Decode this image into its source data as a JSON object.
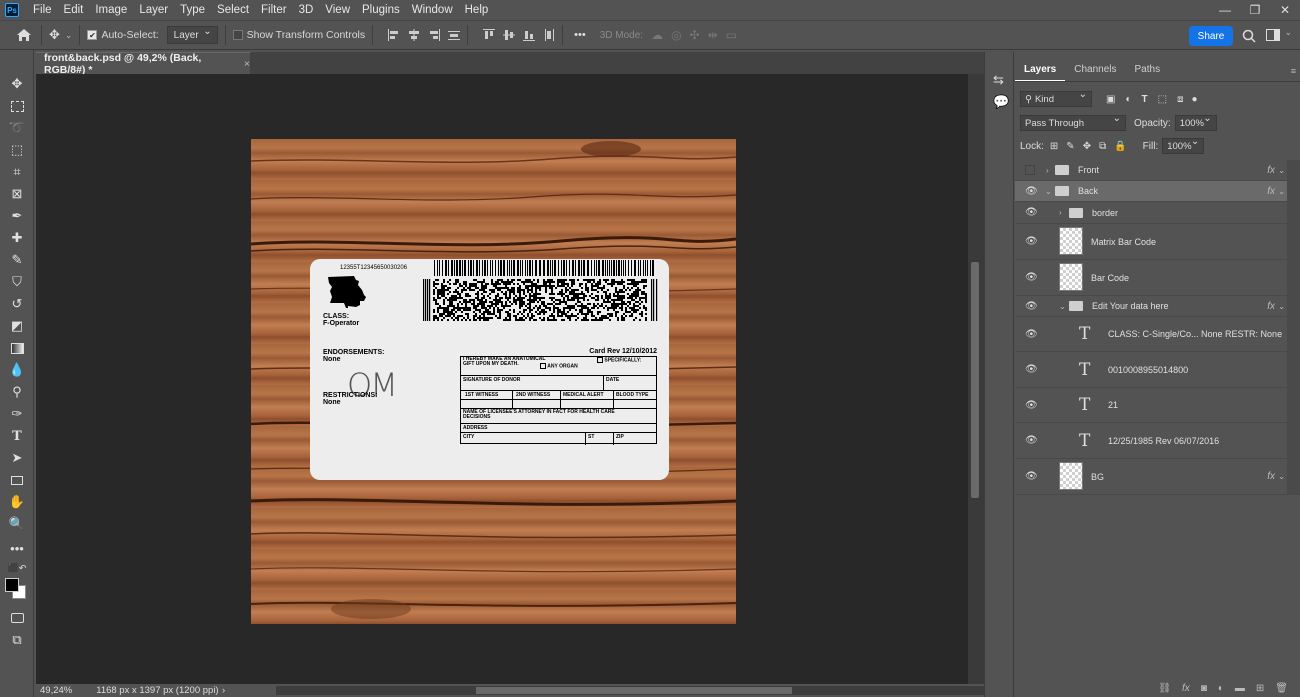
{
  "app": {
    "logo": "Ps"
  },
  "menu": [
    "File",
    "Edit",
    "Image",
    "Layer",
    "Type",
    "Select",
    "Filter",
    "3D",
    "View",
    "Plugins",
    "Window",
    "Help"
  ],
  "options": {
    "auto_select_label": "Auto-Select:",
    "auto_select_value": "Layer",
    "transform_label": "Show Transform Controls",
    "more": "•••",
    "mode3d_label": "3D Mode:",
    "share_label": "Share"
  },
  "document": {
    "tab_title": "front&back.psd @ 49,2% (Back, RGB/8#) *",
    "close": "×",
    "zoom": "49,24%",
    "size_info": "1168 px x 1397 px (1200 ppi)",
    "status_arrow": "›"
  },
  "card": {
    "barcode_number": "12355T12345650030206",
    "class_label": "CLASS:",
    "class_value": "F-Operator",
    "endorsements_label": "ENDORSEMENTS:",
    "endorsements_value": "None",
    "restrictions_label": "RESTRICTIONS:",
    "restrictions_value": "None",
    "signature": "OM",
    "card_rev": "Card Rev 12/10/2012",
    "donor": {
      "line1": "I HEREBY MAKE AN ANATOMICAL",
      "line2": "GIFT UPON MY DEATH.",
      "any_organ": "ANY ORGAN",
      "specifically": "SPECIFICALLY:",
      "signature_of_donor": "SIGNATURE OF DONOR",
      "date": "DATE",
      "witness1": "1ST WITNESS",
      "witness2": "2ND WITNESS",
      "medical_alert": "MEDICAL ALERT",
      "blood_type": "BLOOD TYPE",
      "attorney": "NAME OF LICENSEE'S ATTORNEY IN FACT FOR HEALTH CARE",
      "decisions": "DECISIONS",
      "address": "ADDRESS",
      "city": "CITY",
      "st": "ST",
      "zip": "ZIP"
    }
  },
  "panel": {
    "tabs": [
      "Layers",
      "Channels",
      "Paths"
    ],
    "filter_kind": "Kind",
    "blend_mode": "Pass Through",
    "opacity_label": "Opacity:",
    "opacity_value": "100%",
    "lock_label": "Lock:",
    "fill_label": "Fill:",
    "fill_value": "100%"
  },
  "layers": [
    {
      "name": "Front",
      "type": "group",
      "visible": false,
      "fx": "fx"
    },
    {
      "name": "Back",
      "type": "group",
      "visible": true,
      "fx": "fx",
      "selected": true
    },
    {
      "name": "border",
      "type": "group",
      "visible": true
    },
    {
      "name": "Matrix Bar Code",
      "type": "pixel",
      "visible": true
    },
    {
      "name": "Bar Code",
      "type": "pixel",
      "visible": true
    },
    {
      "name": "Edit Your data here",
      "type": "group",
      "visible": true,
      "fx": "fx"
    },
    {
      "name": "CLASS: C-Single/Co... None RESTR: None",
      "type": "text",
      "visible": true
    },
    {
      "name": "0010008955014800",
      "type": "text",
      "visible": true
    },
    {
      "name": "21",
      "type": "text",
      "visible": true
    },
    {
      "name": "12/25/1985 Rev 06/07/2016",
      "type": "text",
      "visible": true
    },
    {
      "name": "BG",
      "type": "pixel",
      "visible": true,
      "fx": "fx"
    }
  ]
}
